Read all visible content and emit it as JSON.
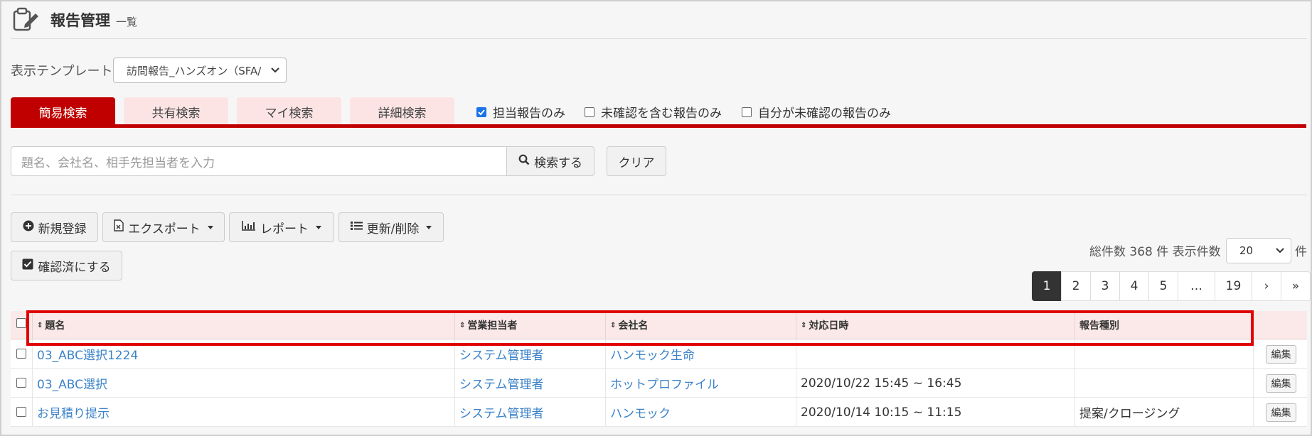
{
  "header": {
    "title": "報告管理",
    "subtitle": "一覧",
    "icon": "report-edit-icon"
  },
  "template": {
    "label": "表示テンプレート",
    "selected": "訪問報告_ハンズオン（SFA/"
  },
  "tabs": [
    {
      "label": "簡易検索",
      "active": true
    },
    {
      "label": "共有検索",
      "active": false
    },
    {
      "label": "マイ検索",
      "active": false
    },
    {
      "label": "詳細検索",
      "active": false
    }
  ],
  "filters": [
    {
      "label": "担当報告のみ",
      "checked": true
    },
    {
      "label": "未確認を含む報告のみ",
      "checked": false
    },
    {
      "label": "自分が未確認の報告のみ",
      "checked": false
    }
  ],
  "search": {
    "placeholder": "題名、会社名、相手先担当者を入力",
    "button": "検索する",
    "clear": "クリア"
  },
  "actions": {
    "new": "新規登録",
    "export": "エクスポート",
    "report": "レポート",
    "update": "更新/削除",
    "confirm": "確認済にする"
  },
  "summary": {
    "total_label": "総件数 368 件 表示件数",
    "per_page": "20",
    "unit": "件"
  },
  "pagination": [
    "1",
    "2",
    "3",
    "4",
    "5",
    "…",
    "19",
    "›",
    "»"
  ],
  "table": {
    "columns": [
      "題名",
      "営業担当者",
      "会社名",
      "対応日時",
      "報告種別"
    ],
    "rows": [
      {
        "title": "03_ABC選択1224",
        "rep": "システム管理者",
        "company": "ハンモック生命",
        "datetime": "",
        "type": "",
        "edit": "編集"
      },
      {
        "title": "03_ABC選択",
        "rep": "システム管理者",
        "company": "ホットプロファイル",
        "datetime": "2020/10/22 15:45 ~ 16:45",
        "type": "",
        "edit": "編集"
      },
      {
        "title": "お見積り提示",
        "rep": "システム管理者",
        "company": "ハンモック",
        "datetime": "2020/10/14 10:15 ~ 11:15",
        "type": "提案/クロージング",
        "edit": "編集"
      }
    ]
  },
  "colors": {
    "accent": "#c00000",
    "tab_inactive": "#fde4e4",
    "link": "#3b83c9",
    "highlight": "#e00000"
  }
}
